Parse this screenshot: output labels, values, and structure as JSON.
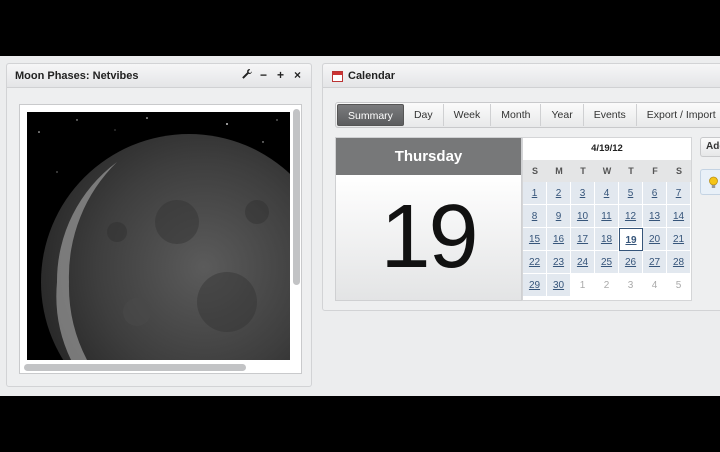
{
  "moon_widget": {
    "title": "Moon Phases: Netvibes",
    "controls": [
      "wrench-icon",
      "minimize-icon",
      "maximize-icon",
      "close-icon"
    ],
    "control_glyphs": {
      "minimize": "−",
      "maximize": "+",
      "close": "×"
    }
  },
  "calendar": {
    "title": "Calendar",
    "tabs": [
      "Summary",
      "Day",
      "Week",
      "Month",
      "Year",
      "Events",
      "Export / Import"
    ],
    "active_tab": "Summary",
    "day_name": "Thursday",
    "day_number": "19",
    "mini_title": "4/19/12",
    "weekdays": [
      "S",
      "M",
      "T",
      "W",
      "T",
      "F",
      "S"
    ],
    "days": [
      [
        "1",
        "2",
        "3",
        "4",
        "5",
        "6",
        "7"
      ],
      [
        "8",
        "9",
        "10",
        "11",
        "12",
        "13",
        "14"
      ],
      [
        "15",
        "16",
        "17",
        "18",
        "19",
        "20",
        "21"
      ],
      [
        "22",
        "23",
        "24",
        "25",
        "26",
        "27",
        "28"
      ],
      [
        "29",
        "30",
        "1",
        "2",
        "3",
        "4",
        "5"
      ]
    ],
    "selected_day": "19",
    "add_button": "Add",
    "tip_icon": "lightbulb-icon"
  }
}
